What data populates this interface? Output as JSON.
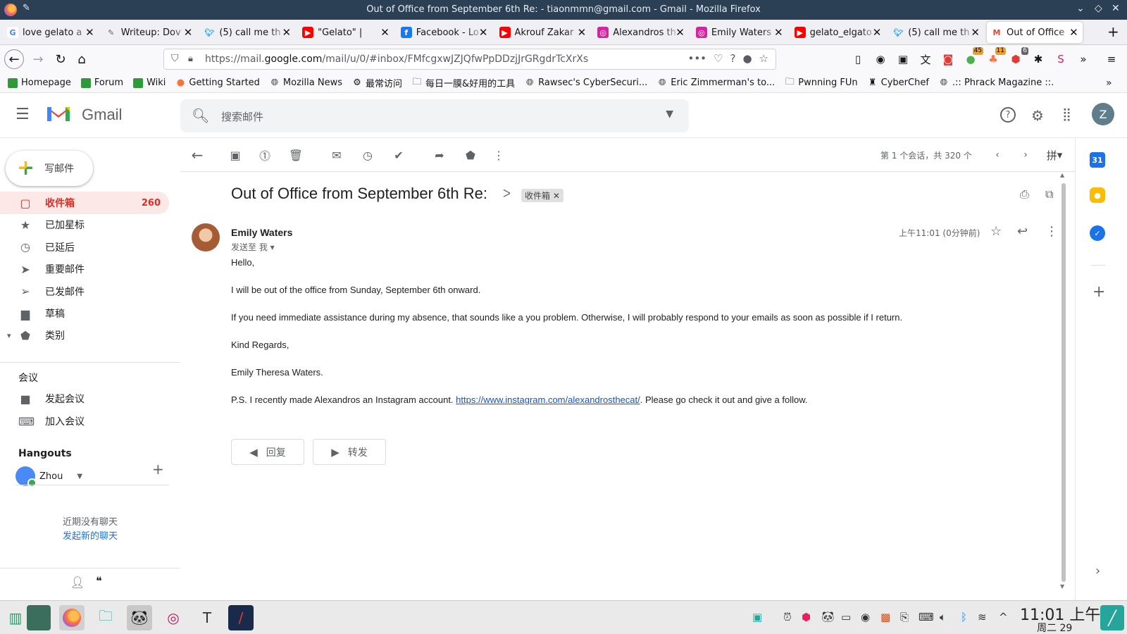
{
  "window": {
    "title": "Out of Office from September 6th Re: - tiaonmmn@gmail.com - Gmail - Mozilla Firefox"
  },
  "tabs": [
    {
      "label": "love gelato a",
      "icon": "google-icon",
      "active": false
    },
    {
      "label": "Writeup: Dov",
      "icon": "writeup-icon",
      "active": false
    },
    {
      "label": "(5) call me th",
      "icon": "twitter-icon",
      "active": false
    },
    {
      "label": "\"Gelato\" |",
      "icon": "youtube-icon",
      "active": false
    },
    {
      "label": "Facebook - Lo",
      "icon": "facebook-icon",
      "active": false
    },
    {
      "label": "Akrouf Zakar",
      "icon": "youtube-icon",
      "active": false
    },
    {
      "label": "Alexandros th",
      "icon": "instagram-icon",
      "active": false
    },
    {
      "label": "Emily Waters",
      "icon": "instagram-icon",
      "active": false
    },
    {
      "label": "gelato_elgato",
      "icon": "youtube-icon",
      "active": false
    },
    {
      "label": "(5) call me th",
      "icon": "twitter-icon",
      "active": false
    },
    {
      "label": "Out of Office",
      "icon": "gmail-icon",
      "active": true
    }
  ],
  "urlbar": {
    "prefix": "https://mail.",
    "domain": "google.com",
    "path": "/mail/u/0/#inbox/FMfcgxwJZJQfwPpDDzjJrGRgdrTcXrXs"
  },
  "bookmarks": [
    {
      "label": "Homepage",
      "icon": "green-square-icon"
    },
    {
      "label": "Forum",
      "icon": "green-square-icon"
    },
    {
      "label": "Wiki",
      "icon": "green-square-icon"
    },
    {
      "label": "Getting Started",
      "icon": "firefox-icon"
    },
    {
      "label": "Mozilla News",
      "icon": "globe-icon"
    },
    {
      "label": "最常访问",
      "icon": "gear-icon"
    },
    {
      "label": "每日一膜&好用的工具",
      "icon": "folder-icon"
    },
    {
      "label": "Rawsec's CyberSecuri...",
      "icon": "globe-icon"
    },
    {
      "label": "Eric Zimmerman's to...",
      "icon": "globe-icon"
    },
    {
      "label": "Pwnning FUn",
      "icon": "folder-icon"
    },
    {
      "label": "CyberChef",
      "icon": "cyberchef-icon"
    },
    {
      "label": ".:: Phrack Magazine ::.",
      "icon": "globe-icon"
    }
  ],
  "toolbar_badges": {
    "a": "45",
    "b": "11",
    "c": "6"
  },
  "gmail": {
    "brand": "Gmail",
    "search_placeholder": "搜索邮件",
    "account_initial": "Z",
    "compose_label": "写邮件",
    "nav": [
      {
        "label": "收件箱",
        "icon": "inbox-icon",
        "count": "260",
        "active": true
      },
      {
        "label": "已加星标",
        "icon": "star-icon",
        "count": "",
        "active": false
      },
      {
        "label": "已延后",
        "icon": "clock-icon",
        "count": "",
        "active": false
      },
      {
        "label": "重要邮件",
        "icon": "important-icon",
        "count": "",
        "active": false
      },
      {
        "label": "已发邮件",
        "icon": "send-icon",
        "count": "",
        "active": false
      },
      {
        "label": "草稿",
        "icon": "draft-icon",
        "count": "",
        "active": false
      },
      {
        "label": "类别",
        "icon": "label-icon",
        "count": "",
        "active": false
      }
    ],
    "meet": {
      "title": "会议",
      "start": "发起会议",
      "join": "加入会议"
    },
    "hangouts": {
      "title": "Hangouts",
      "user": "Zhou",
      "no_chats": "近期没有聊天",
      "start_chat": "发起新的聊天"
    },
    "paging": "第 1 个会话，共 320 个",
    "input_tool": "拼",
    "email": {
      "subject": "Out of Office from September 6th Re:",
      "label_chip": "收件箱",
      "sender": "Emily Waters",
      "sent_to": "发送至 我",
      "time": "上午11:01 (0分钟前)",
      "greeting": "Hello,",
      "p1": "I will be out of the office from Sunday, September 6th onward.",
      "p2": "If you need immediate assistance during my absence, that sounds like a you problem. Otherwise, I will probably respond to your emails as soon as possible if I return.",
      "closing": "Kind Regards,",
      "signature": "Emily Theresa Waters.",
      "ps_before": "P.S. I recently made Alexandros an Instagram account. ",
      "ps_link": "https://www.instagram.com/alexandrosthecat/",
      "ps_after": ". Please go check it out and give a follow."
    },
    "reply_label": "回复",
    "forward_label": "转发"
  },
  "taskbar": {
    "time": "11:01 上午",
    "date": "周二 29"
  }
}
